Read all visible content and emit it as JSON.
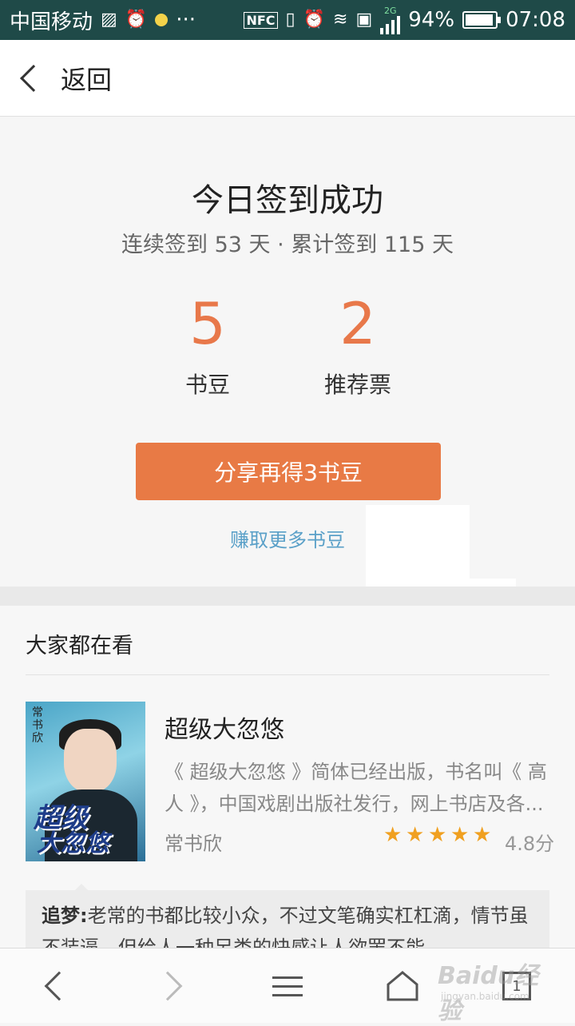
{
  "status_bar": {
    "carrier": "中国移动",
    "nfc": "NFC",
    "network": "2G",
    "battery": "94%",
    "battery_level": 0.94,
    "time": "07:08",
    "more": "···"
  },
  "header": {
    "back_label": "返回"
  },
  "signin": {
    "title": "今日签到成功",
    "subtitle": "连续签到 53 天 · 累计签到 115 天",
    "rewards": [
      {
        "value": "5",
        "label": "书豆"
      },
      {
        "value": "2",
        "label": "推荐票"
      }
    ],
    "share_button": "分享再得3书豆",
    "earn_link": "赚取更多书豆"
  },
  "recommend": {
    "section_title": "大家都在看",
    "book": {
      "title": "超级大忽悠",
      "description": "《 超级大忽悠 》简体已经出版，书名叫《 高人 》，中国戏剧出版社发行，网上书店及各...",
      "author": "常书欣",
      "rating": "4.8分",
      "stars": 5,
      "cover_title_1": "超级",
      "cover_title_2": "大忽悠",
      "cover_author": "常书欣"
    },
    "comment": {
      "user": "追梦:",
      "text": "老常的书都比较小众，不过文笔确实杠杠滴，情节虽不装逼，但给人一种另类的快感让人欲罢不能"
    }
  },
  "navbar": {
    "tabs_count": "1"
  },
  "watermark": {
    "text": "Baidu经验",
    "sub": "jingyan.baidu.com"
  },
  "colors": {
    "accent": "#e8784a",
    "status_bar": "#1f4a48",
    "link": "#5aa0c8",
    "star": "#f0a020"
  }
}
